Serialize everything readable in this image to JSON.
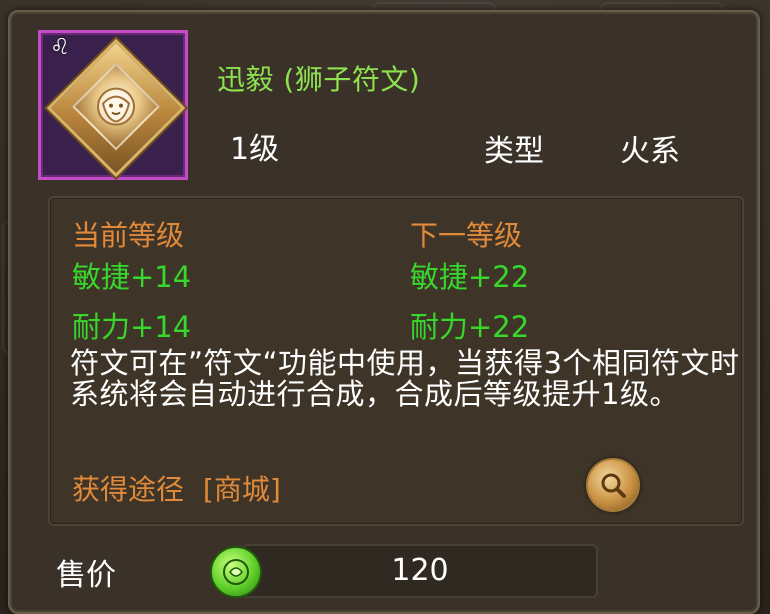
{
  "item": {
    "name": "迅毅 (狮子符文)",
    "level": "1级",
    "type_label": "类型",
    "type_value": "火系",
    "icon_name": "lion-rune-icon",
    "zodiac_symbol": "♌",
    "frame_color": "#c44cc6"
  },
  "stats": {
    "current": {
      "header": "当前等级",
      "agility": "敏捷+14",
      "stamina": "耐力+14"
    },
    "next": {
      "header": "下一等级",
      "agility": "敏捷+22",
      "stamina": "耐力+22"
    }
  },
  "description": "符文可在”符文“功能中使用，当获得3个相同符文时系统将会自动进行合成，合成后等级提升1级。",
  "obtain": {
    "label": "获得途径",
    "source": "[商城]"
  },
  "price": {
    "label": "售价",
    "value": "120",
    "currency_icon": "green-coin-icon"
  },
  "colors": {
    "name": "#8fe24f",
    "header": "#e08a3a",
    "stat": "#37d72c",
    "text": "#ffffff"
  }
}
